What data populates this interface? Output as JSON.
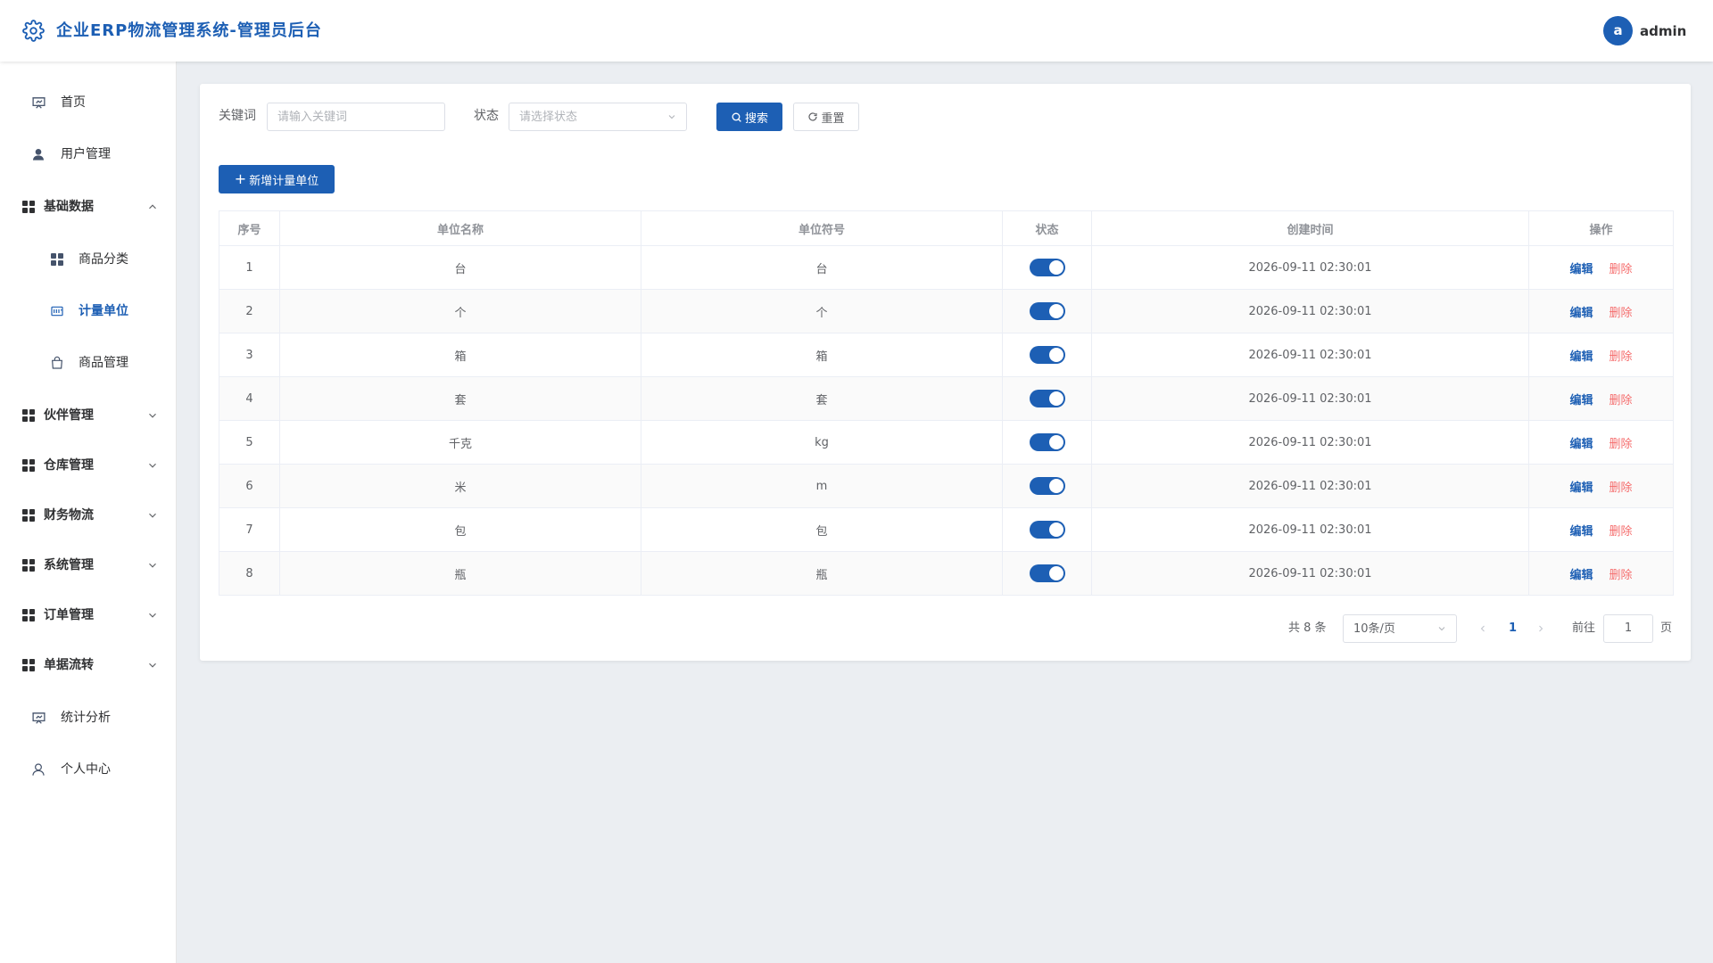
{
  "header": {
    "title": "企业ERP物流管理系统-管理员后台",
    "logo_icon": "gear-icon",
    "avatar_letter": "a",
    "username": "admin"
  },
  "sidebar": {
    "items": [
      {
        "label": "首页",
        "icon": "presentation-icon"
      },
      {
        "label": "用户管理",
        "icon": "user-icon"
      },
      {
        "label": "基础数据",
        "icon": "grid-icon",
        "expanded": true
      },
      {
        "label": "商品分类",
        "icon": "grid-icon"
      },
      {
        "label": "计量单位",
        "icon": "ruler-icon",
        "active": true
      },
      {
        "label": "商品管理",
        "icon": "bag-icon"
      },
      {
        "label": "伙伴管理",
        "icon": "grid-icon"
      },
      {
        "label": "仓库管理",
        "icon": "grid-icon"
      },
      {
        "label": "财务物流",
        "icon": "grid-icon"
      },
      {
        "label": "系统管理",
        "icon": "grid-icon"
      },
      {
        "label": "订单管理",
        "icon": "grid-icon"
      },
      {
        "label": "单据流转",
        "icon": "grid-icon"
      },
      {
        "label": "统计分析",
        "icon": "presentation-icon"
      },
      {
        "label": "个人中心",
        "icon": "user-outline-icon"
      }
    ]
  },
  "filters": {
    "keyword_label": "关键词",
    "keyword_placeholder": "请输入关键词",
    "status_label": "状态",
    "status_placeholder": "请选择状态",
    "search_label": "搜索",
    "reset_label": "重置"
  },
  "add_button_label": "新增计量单位",
  "table": {
    "columns": [
      "序号",
      "单位名称",
      "单位符号",
      "状态",
      "创建时间",
      "操作"
    ],
    "rows": [
      {
        "index": "1",
        "name": "台",
        "symbol": "台",
        "enabled": true,
        "created": "2026-09-11 02:30:01"
      },
      {
        "index": "2",
        "name": "个",
        "symbol": "个",
        "enabled": true,
        "created": "2026-09-11 02:30:01"
      },
      {
        "index": "3",
        "name": "箱",
        "symbol": "箱",
        "enabled": true,
        "created": "2026-09-11 02:30:01"
      },
      {
        "index": "4",
        "name": "套",
        "symbol": "套",
        "enabled": true,
        "created": "2026-09-11 02:30:01"
      },
      {
        "index": "5",
        "name": "千克",
        "symbol": "kg",
        "enabled": true,
        "created": "2026-09-11 02:30:01"
      },
      {
        "index": "6",
        "name": "米",
        "symbol": "m",
        "enabled": true,
        "created": "2026-09-11 02:30:01"
      },
      {
        "index": "7",
        "name": "包",
        "symbol": "包",
        "enabled": true,
        "created": "2026-09-11 02:30:01"
      },
      {
        "index": "8",
        "name": "瓶",
        "symbol": "瓶",
        "enabled": true,
        "created": "2026-09-11 02:30:01"
      }
    ],
    "edit_label": "编辑",
    "delete_label": "删除"
  },
  "pagination": {
    "total_text": "共 8 条",
    "page_size": "10条/页",
    "current_page": "1",
    "goto_label": "前往",
    "goto_value": "1",
    "page_suffix": "页"
  },
  "colors": {
    "primary": "#1d5fb4",
    "danger": "#f56c6c",
    "background": "#ebeef2"
  }
}
